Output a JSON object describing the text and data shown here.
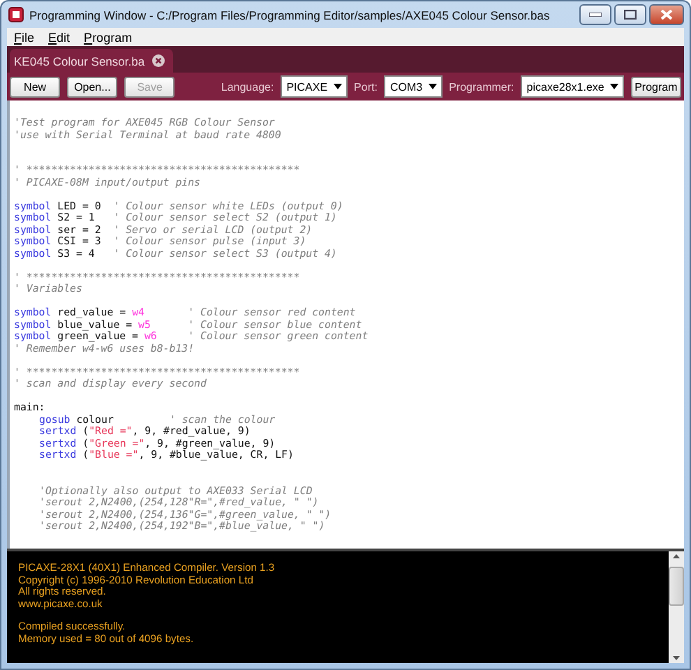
{
  "window": {
    "title": "Programming Window - C:/Program Files/Programming Editor/samples/AXE045 Colour Sensor.bas"
  },
  "menu": [
    "File",
    "Edit",
    "Program"
  ],
  "tabs": [
    {
      "label": "KE045 Colour Sensor.ba",
      "selected": true
    }
  ],
  "toolbar": {
    "buttons": [
      {
        "label": "New",
        "disabled": false
      },
      {
        "label": "Open...",
        "disabled": false
      },
      {
        "label": "Save",
        "disabled": true
      }
    ],
    "selects": [
      {
        "label": "Language:",
        "value": "PICAXE"
      },
      {
        "label": "Port:",
        "value": "COM3"
      },
      {
        "label": "Programmer:",
        "value": "picaxe28x1.exe"
      }
    ],
    "action": {
      "label": "Program",
      "disabled": false
    }
  },
  "code": [
    {
      "kind": "line",
      "indented": false,
      "segments": [
        {
          "kind": "comment",
          "text": "'Test program for AXE045 RGB Colour Sensor"
        }
      ]
    },
    {
      "kind": "line",
      "indented": false,
      "segments": [
        {
          "kind": "comment",
          "text": "'use with Serial Terminal at baud rate 4800"
        }
      ]
    },
    {
      "kind": "blank"
    },
    {
      "kind": "blank"
    },
    {
      "kind": "line",
      "indented": false,
      "segments": [
        {
          "kind": "comment",
          "text": "' ********************************************"
        }
      ]
    },
    {
      "kind": "line",
      "indented": false,
      "segments": [
        {
          "kind": "comment",
          "text": "' PICAXE-08M input/output pins"
        }
      ]
    },
    {
      "kind": "blank"
    },
    {
      "kind": "line",
      "indented": false,
      "segments": [
        {
          "kind": "keyword",
          "text": "symbol"
        },
        {
          "kind": "plain",
          "text": " LED = 0  "
        },
        {
          "kind": "comment",
          "text": "' Colour sensor white LEDs (output 0)"
        }
      ]
    },
    {
      "kind": "line",
      "indented": false,
      "segments": [
        {
          "kind": "keyword",
          "text": "symbol"
        },
        {
          "kind": "plain",
          "text": " S2 = 1   "
        },
        {
          "kind": "comment",
          "text": "' Colour sensor select S2 (output 1)"
        }
      ]
    },
    {
      "kind": "line",
      "indented": false,
      "segments": [
        {
          "kind": "keyword",
          "text": "symbol"
        },
        {
          "kind": "plain",
          "text": " ser = 2  "
        },
        {
          "kind": "comment",
          "text": "' Servo or serial LCD (output 2)"
        }
      ]
    },
    {
      "kind": "line",
      "indented": false,
      "segments": [
        {
          "kind": "keyword",
          "text": "symbol"
        },
        {
          "kind": "plain",
          "text": " CSI = 3  "
        },
        {
          "kind": "comment",
          "text": "' Colour sensor pulse (input 3)"
        }
      ]
    },
    {
      "kind": "line",
      "indented": false,
      "segments": [
        {
          "kind": "keyword",
          "text": "symbol"
        },
        {
          "kind": "plain",
          "text": " S3 = 4   "
        },
        {
          "kind": "comment",
          "text": "' Colour sensor select S3 (output 4)"
        }
      ]
    },
    {
      "kind": "blank"
    },
    {
      "kind": "line",
      "indented": false,
      "segments": [
        {
          "kind": "comment",
          "text": "' ********************************************"
        }
      ]
    },
    {
      "kind": "line",
      "indented": false,
      "segments": [
        {
          "kind": "comment",
          "text": "' Variables"
        }
      ]
    },
    {
      "kind": "blank"
    },
    {
      "kind": "line",
      "indented": false,
      "segments": [
        {
          "kind": "keyword",
          "text": "symbol"
        },
        {
          "kind": "plain",
          "text": " red_value = "
        },
        {
          "kind": "variable",
          "text": "w4       "
        },
        {
          "kind": "comment",
          "text": "' Colour sensor red content"
        }
      ]
    },
    {
      "kind": "line",
      "indented": false,
      "segments": [
        {
          "kind": "keyword",
          "text": "symbol"
        },
        {
          "kind": "plain",
          "text": " blue_value = "
        },
        {
          "kind": "variable",
          "text": "w5      "
        },
        {
          "kind": "comment",
          "text": "' Colour sensor blue content"
        }
      ]
    },
    {
      "kind": "line",
      "indented": false,
      "segments": [
        {
          "kind": "keyword",
          "text": "symbol"
        },
        {
          "kind": "plain",
          "text": " green_value = "
        },
        {
          "kind": "variable",
          "text": "w6     "
        },
        {
          "kind": "comment",
          "text": "' Colour sensor green content"
        }
      ]
    },
    {
      "kind": "line",
      "indented": false,
      "segments": [
        {
          "kind": "comment",
          "text": "' Remember w4-w6 uses b8-b13!"
        }
      ]
    },
    {
      "kind": "blank"
    },
    {
      "kind": "line",
      "indented": false,
      "segments": [
        {
          "kind": "comment",
          "text": "' ********************************************"
        }
      ]
    },
    {
      "kind": "line",
      "indented": false,
      "segments": [
        {
          "kind": "comment",
          "text": "' scan and display every second"
        }
      ]
    },
    {
      "kind": "blank"
    },
    {
      "kind": "line",
      "indented": false,
      "segments": [
        {
          "kind": "plain",
          "text": "main:"
        }
      ]
    },
    {
      "kind": "line",
      "indented": true,
      "segments": [
        {
          "kind": "keyword",
          "text": "gosub"
        },
        {
          "kind": "plain",
          "text": " colour         "
        },
        {
          "kind": "comment",
          "text": "' scan the colour"
        }
      ]
    },
    {
      "kind": "line",
      "indented": true,
      "segments": [
        {
          "kind": "keyword",
          "text": "sertxd"
        },
        {
          "kind": "plain",
          "text": " ("
        },
        {
          "kind": "string",
          "text": "\"Red =\""
        },
        {
          "kind": "plain",
          "text": ", 9, #red_value, 9)"
        }
      ]
    },
    {
      "kind": "line",
      "indented": true,
      "segments": [
        {
          "kind": "keyword",
          "text": "sertxd"
        },
        {
          "kind": "plain",
          "text": " ("
        },
        {
          "kind": "string",
          "text": "\"Green =\""
        },
        {
          "kind": "plain",
          "text": ", 9, #green_value, 9)"
        }
      ]
    },
    {
      "kind": "line",
      "indented": true,
      "segments": [
        {
          "kind": "keyword",
          "text": "sertxd"
        },
        {
          "kind": "plain",
          "text": " ("
        },
        {
          "kind": "string",
          "text": "\"Blue =\""
        },
        {
          "kind": "plain",
          "text": ", 9, #blue_value, CR, LF)"
        }
      ]
    },
    {
      "kind": "blank"
    },
    {
      "kind": "blank"
    },
    {
      "kind": "line",
      "indented": true,
      "segments": [
        {
          "kind": "comment",
          "text": "'Optionally also output to AXE033 Serial LCD"
        }
      ]
    },
    {
      "kind": "line",
      "indented": true,
      "segments": [
        {
          "kind": "comment",
          "text": "'serout 2,N2400,(254,128\"R=\",#red_value, \" \")"
        }
      ]
    },
    {
      "kind": "line",
      "indented": true,
      "segments": [
        {
          "kind": "comment",
          "text": "'serout 2,N2400,(254,136\"G=\",#green_value, \" \")"
        }
      ]
    },
    {
      "kind": "line",
      "indented": true,
      "segments": [
        {
          "kind": "comment",
          "text": "'serout 2,N2400,(254,192\"B=\",#blue_value, \" \")"
        }
      ]
    }
  ],
  "console": {
    "paragraphs": [
      [
        "PICAXE-28X1 (40X1) Enhanced Compiler. Version 1.3",
        "Copyright (c) 1996-2010 Revolution Education Ltd",
        "All rights reserved.",
        "www.picaxe.co.uk"
      ],
      [
        "Compiled successfully.",
        "Memory used = 80 out of 4096 bytes."
      ]
    ]
  }
}
